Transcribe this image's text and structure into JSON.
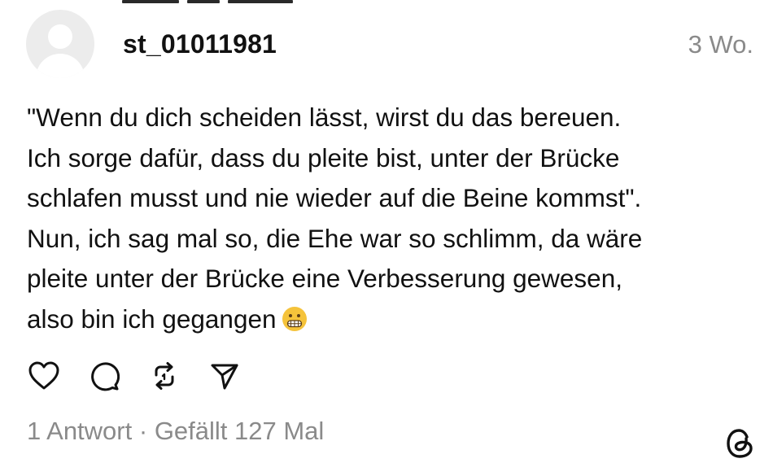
{
  "post": {
    "username": "st_01011981",
    "timestamp": "3 Wo.",
    "text_lines": [
      "\"Wenn du dich scheiden lässt, wirst du das bereuen.",
      "Ich sorge dafür, dass du pleite bist, unter der Brücke",
      "schlafen musst und nie wieder auf die Beine kommst\".",
      "Nun, ich sag mal so, die Ehe war so schlimm, da wäre",
      "pleite unter der Brücke eine Verbesserung gewesen,",
      "also bin ich gegangen"
    ],
    "emoji": "grimacing-face-emoji",
    "actions": [
      {
        "name": "like",
        "icon": "heart-icon"
      },
      {
        "name": "reply",
        "icon": "comment-icon"
      },
      {
        "name": "repost",
        "icon": "repost-icon"
      },
      {
        "name": "share",
        "icon": "send-icon"
      }
    ],
    "stats": {
      "replies": "1 Antwort",
      "separator": " · ",
      "likes": "Gefällt 127 Mal"
    }
  },
  "branding": {
    "logo": "threads-logo-icon"
  },
  "colors": {
    "text": "#111111",
    "muted": "#8a8a8a",
    "avatar_bg": "#ececec",
    "emoji_yellow": "#f5c33b"
  }
}
